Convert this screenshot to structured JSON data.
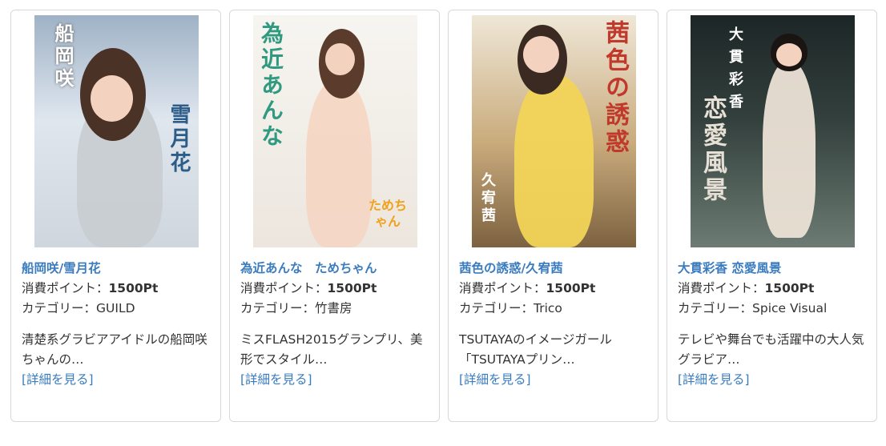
{
  "products": [
    {
      "title": "船岡咲/雪月花",
      "points_label": "消費ポイント：",
      "points_value": "1500Pt",
      "category_label": "カテゴリー：",
      "category_value": "GUILD",
      "description": "清楚系グラビアアイドルの船岡咲ちゃんの…",
      "detail_link": "[詳細を見る]",
      "cover_text": "船岡咲",
      "cover_text2": "雪月花",
      "colors": {
        "bg1": "#b8c7d6",
        "bg2": "#e9eef3",
        "text": "#ffffff"
      }
    },
    {
      "title": "為近あんな　ためちゃん",
      "points_label": "消費ポイント：",
      "points_value": "1500Pt",
      "category_label": "カテゴリー：",
      "category_value": "竹書房",
      "description": "ミスFLASH2015グランプリ、美形でスタイル…",
      "detail_link": "[詳細を見る]",
      "cover_text": "為近あんな",
      "cover_text2": "ためちゃん",
      "colors": {
        "bg1": "#f6f3ee",
        "bg2": "#e8e2da",
        "text": "#2f9a7f"
      }
    },
    {
      "title": "茜色の誘惑/久宥茜",
      "points_label": "消費ポイント：",
      "points_value": "1500Pt",
      "category_label": "カテゴリー：",
      "category_value": "Trico",
      "description": "TSUTAYAのイメージガール「TSUTAYAプリン…",
      "detail_link": "[詳細を見る]",
      "cover_text": "茜色の誘惑",
      "cover_text2": "久宥茜",
      "colors": {
        "bg1": "#e6d7b8",
        "bg2": "#9a7a4c",
        "text": "#c0392b"
      }
    },
    {
      "title": "大貫彩香 恋愛風景",
      "points_label": "消費ポイント：",
      "points_value": "1500Pt",
      "category_label": "カテゴリー：",
      "category_value": "Spice Visual",
      "description": "テレビや舞台でも活躍中の大人気グラビア…",
      "detail_link": "[詳細を見る]",
      "cover_text": "大貫彩香",
      "cover_text2": "恋愛風景",
      "colors": {
        "bg1": "#1f2a2a",
        "bg2": "#5b6c66",
        "text": "#ffffff"
      }
    }
  ]
}
